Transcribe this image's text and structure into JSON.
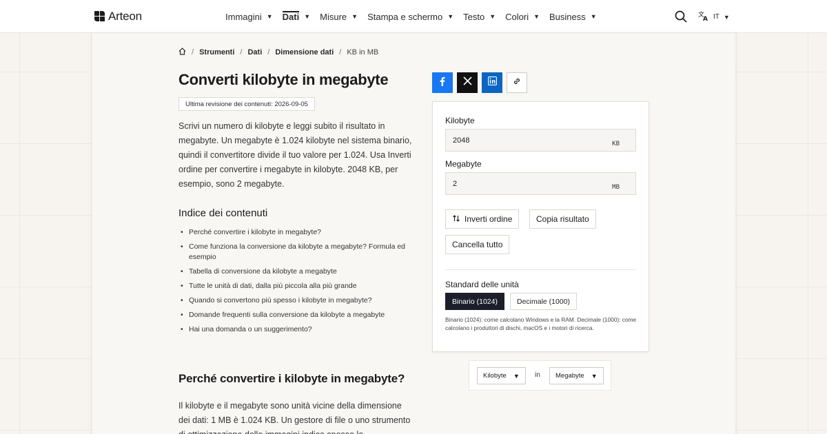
{
  "header": {
    "logo": "Arteon",
    "nav": [
      {
        "label": "Immagini",
        "active": false
      },
      {
        "label": "Dati",
        "active": true
      },
      {
        "label": "Misure",
        "active": false
      },
      {
        "label": "Stampa e schermo",
        "active": false
      },
      {
        "label": "Testo",
        "active": false
      },
      {
        "label": "Colori",
        "active": false
      },
      {
        "label": "Business",
        "active": false
      }
    ],
    "language": "IT"
  },
  "breadcrumb": {
    "items": [
      "Strumenti",
      "Dati",
      "Dimensione dati"
    ],
    "current": "KB in MB"
  },
  "page": {
    "title": "Converti kilobyte in megabyte",
    "revision": "Ultima revisione dei contenuti: 2026-09-05",
    "intro": "Scrivi un numero di kilobyte e leggi subito il risultato in megabyte. Un megabyte è 1.024 kilobyte nel sistema binario, quindi il convertitore divide il tuo valore per 1.024. Usa Inverti ordine per convertire i megabyte in kilobyte. 2048 KB, per esempio, sono 2 megabyte.",
    "toc_title": "Indice dei contenuti",
    "toc": [
      "Perché convertire i kilobyte in megabyte?",
      "Come funziona la conversione da kilobyte a megabyte? Formula ed esempio",
      "Tabella di conversione da kilobyte a megabyte",
      "Tutte le unità di dati, dalla più piccola alla più grande",
      "Quando si convertono più spesso i kilobyte in megabyte?",
      "Domande frequenti sulla conversione da kilobyte a megabyte",
      "Hai una domanda o un suggerimento?"
    ],
    "section_title": "Perché convertire i kilobyte in megabyte?",
    "section_text": "Il kilobyte e il megabyte sono unità vicine della dimensione dei dati: 1 MB è 1.024 KB. Un gestore di file o uno strumento di ottimizzazione delle immagini indica spesso la"
  },
  "converter": {
    "from_label": "Kilobyte",
    "from_value": "2048",
    "from_unit": "KB",
    "to_label": "Megabyte",
    "to_value": "2",
    "to_unit": "MB",
    "swap_label": "Inverti ordine",
    "copy_label": "Copia risultato",
    "clear_label": "Cancella tutto",
    "standard_title": "Standard delle unità",
    "binary_label": "Binario (1024)",
    "decimal_label": "Decimale (1000)",
    "standard_note": "Binario (1024): come calcolano Windows e la RAM. Decimale (1000): come calcolano i produttori di dischi, macOS e i motori di ricerca."
  },
  "unit_select": {
    "from": "Kilobyte",
    "joiner": "in",
    "to": "Megabyte"
  },
  "colors": {
    "facebook": "#1877f2",
    "x": "#111111",
    "linkedin": "#0a66c2",
    "segment_active": "#1c1f2b"
  },
  "icons": [
    "home-icon",
    "search-icon",
    "translate-icon",
    "facebook-icon",
    "x-icon",
    "linkedin-icon",
    "link-icon",
    "swap-icon",
    "chevron-down-icon"
  ]
}
